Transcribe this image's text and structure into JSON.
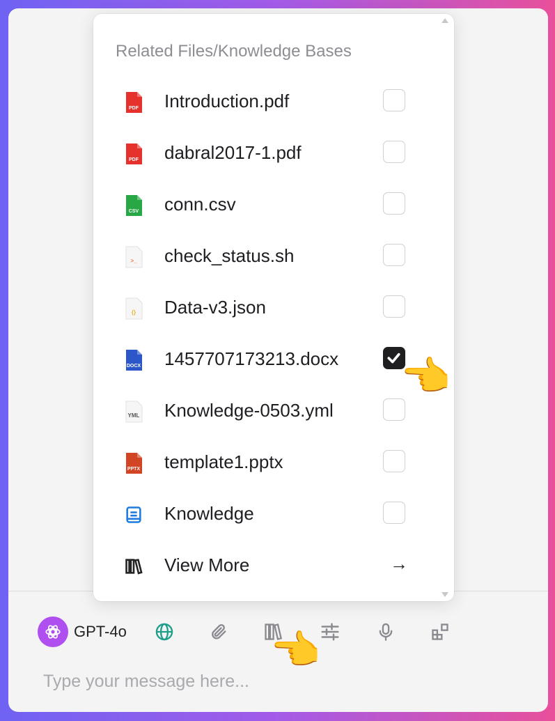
{
  "popup": {
    "title": "Related Files/Knowledge Bases",
    "items": [
      {
        "name": "Introduction.pdf",
        "type": "pdf",
        "badge": "PDF",
        "color": "#e5322d",
        "checked": false
      },
      {
        "name": "dabral2017-1.pdf",
        "type": "pdf",
        "badge": "PDF",
        "color": "#e5322d",
        "checked": false
      },
      {
        "name": "conn.csv",
        "type": "csv",
        "badge": "CSV",
        "color": "#27a844",
        "checked": false
      },
      {
        "name": "check_status.sh",
        "type": "sh",
        "badge": ">_",
        "color": "#f07a4a",
        "checked": false
      },
      {
        "name": "Data-v3.json",
        "type": "json",
        "badge": "{}",
        "color": "#f2b233",
        "checked": false
      },
      {
        "name": "1457707173213.docx",
        "type": "docx",
        "badge": "DOCX",
        "color": "#2b57c8",
        "checked": true
      },
      {
        "name": "Knowledge-0503.yml",
        "type": "yml",
        "badge": "YML",
        "color": "#555555",
        "checked": false
      },
      {
        "name": "template1.pptx",
        "type": "pptx",
        "badge": "PPTX",
        "color": "#d14424",
        "checked": false
      },
      {
        "name": "Knowledge",
        "type": "knowledge",
        "badge": "",
        "color": "#1f7ae0",
        "checked": false
      }
    ],
    "view_more": "View More"
  },
  "toolbar": {
    "model_label": "GPT-4o",
    "icons": [
      "openai-icon",
      "globe-icon",
      "paperclip-icon",
      "library-icon",
      "sliders-icon",
      "microphone-icon",
      "apps-icon"
    ]
  },
  "input": {
    "placeholder": "Type your message here..."
  },
  "colors": {
    "accent_purple": "#b04ff0",
    "globe_teal": "#1f9e8a",
    "checked_box": "#1f1f22"
  }
}
